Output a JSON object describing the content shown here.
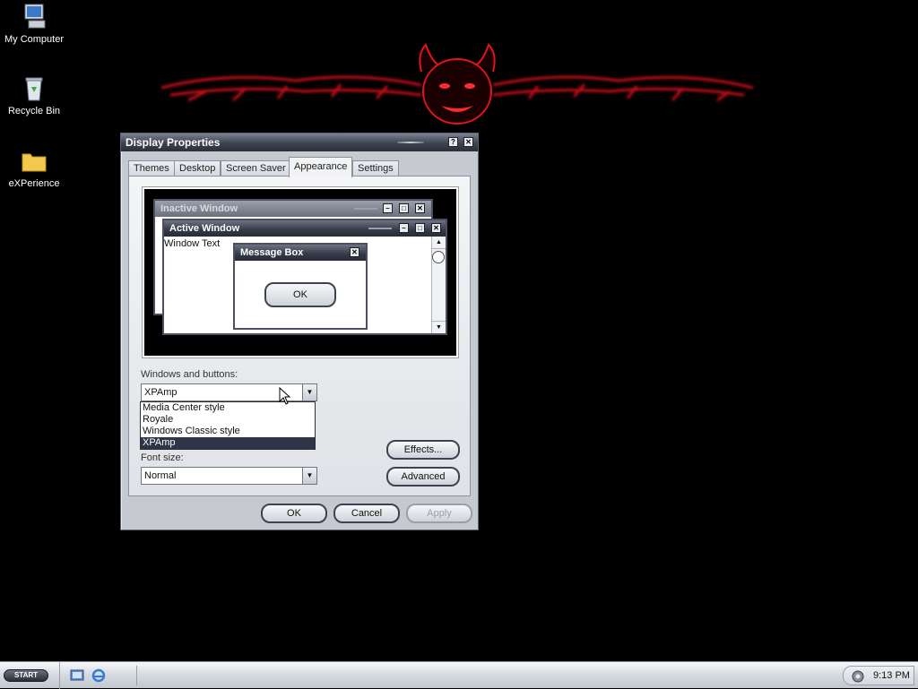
{
  "desktop_icons": [
    {
      "label": "My Computer",
      "icon": "computer-icon"
    },
    {
      "label": "Recycle Bin",
      "icon": "recycle-bin-icon"
    },
    {
      "label": "eXPerience",
      "icon": "folder-icon"
    }
  ],
  "dialog": {
    "title": "Display Properties",
    "tabs": [
      "Themes",
      "Desktop",
      "Screen Saver",
      "Appearance",
      "Settings"
    ],
    "active_tab": "Appearance",
    "preview": {
      "inactive_title": "Inactive Window",
      "active_title": "Active Window",
      "window_text": "Window Text",
      "message_title": "Message Box",
      "ok_label": "OK"
    },
    "windows_buttons_label": "Windows and buttons:",
    "windows_buttons_value": "XPAmp",
    "style_options": [
      "Media Center style",
      "Royale",
      "Windows Classic style",
      "XPAmp"
    ],
    "selected_option": "XPAmp",
    "font_size_label": "Font size:",
    "font_size_value": "Normal",
    "effects_label": "Effects...",
    "advanced_label": "Advanced",
    "ok_label": "OK",
    "cancel_label": "Cancel",
    "apply_label": "Apply"
  },
  "taskbar": {
    "start_label": "START",
    "clock": "9:13 PM"
  },
  "colors": {
    "desktop_bg": "#000000",
    "wallpaper_accent": "#c8101c",
    "title_dark": "#2b2f3a",
    "selection": "#2f3447"
  }
}
